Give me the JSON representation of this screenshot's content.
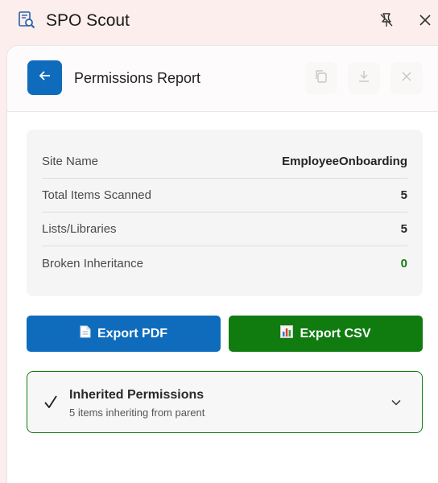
{
  "window": {
    "title": "SPO Scout",
    "icons": {
      "app": "search-document-icon",
      "pin": "unpin-icon",
      "close": "close-icon"
    }
  },
  "header": {
    "title": "Permissions Report",
    "back_icon": "arrow-left-icon",
    "actions": [
      "copy-icon",
      "download-icon",
      "close-icon"
    ]
  },
  "summary": {
    "rows": [
      {
        "label": "Site Name",
        "value": "EmployeeOnboarding"
      },
      {
        "label": "Total Items Scanned",
        "value": "5"
      },
      {
        "label": "Lists/Libraries",
        "value": "5"
      },
      {
        "label": "Broken Inheritance",
        "value": "0"
      }
    ]
  },
  "export": {
    "pdf_label": "Export PDF",
    "csv_label": "Export CSV"
  },
  "inherited": {
    "title": "Inherited Permissions",
    "subtitle": "5 items inheriting from parent"
  },
  "colors": {
    "primary": "#0f6cbd",
    "success": "#107c10",
    "titlebar_bg": "#fbeeec"
  }
}
